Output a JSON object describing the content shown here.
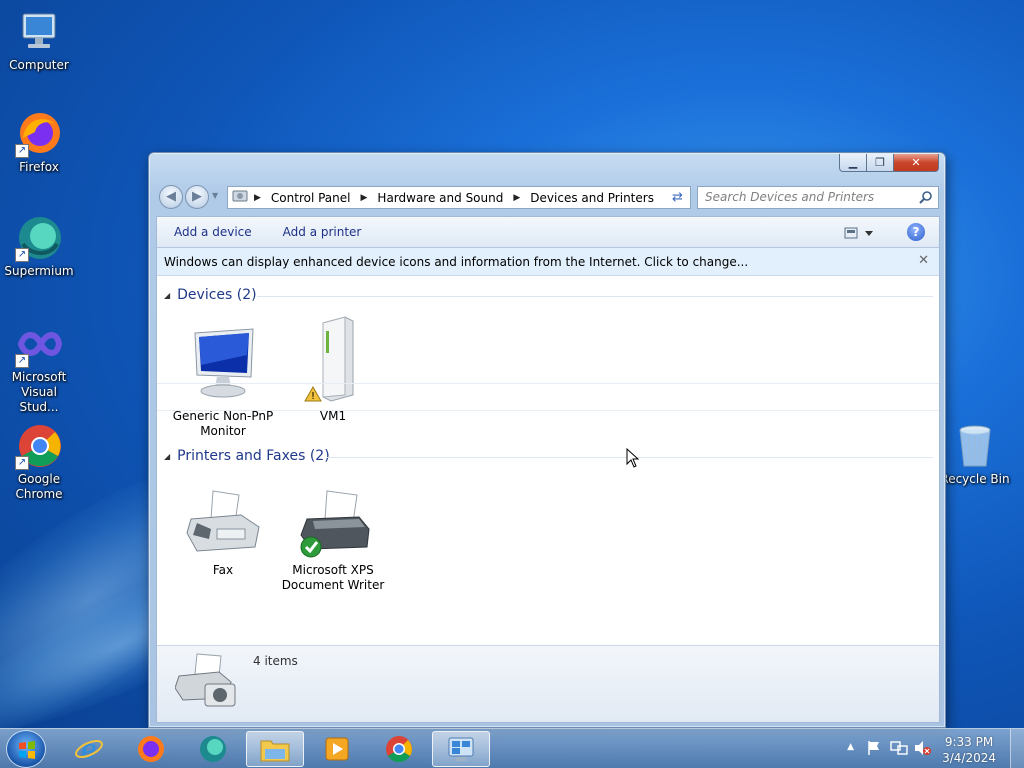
{
  "desktop": {
    "icons": [
      {
        "label": "Computer"
      },
      {
        "label": "Firefox"
      },
      {
        "label": "Supermium"
      },
      {
        "label": "Microsoft Visual Stud..."
      },
      {
        "label": "Google Chrome"
      },
      {
        "label": "Recycle Bin"
      }
    ]
  },
  "window": {
    "breadcrumb": [
      "Control Panel",
      "Hardware and Sound",
      "Devices and Printers"
    ],
    "search_placeholder": "Search Devices and Printers",
    "commands": {
      "add_device": "Add a device",
      "add_printer": "Add a printer"
    },
    "infobar_text": "Windows can display enhanced device icons and information from the Internet. Click to change...",
    "groups": [
      {
        "title": "Devices (2)",
        "items": [
          {
            "label": "Generic Non-PnP Monitor"
          },
          {
            "label": "VM1"
          }
        ]
      },
      {
        "title": "Printers and Faxes (2)",
        "items": [
          {
            "label": "Fax"
          },
          {
            "label": "Microsoft XPS Document Writer"
          }
        ]
      }
    ],
    "details_count": "4 items"
  },
  "taskbar": {
    "clock_time": "9:33 PM",
    "clock_date": "3/4/2024",
    "apps": [
      "internet-explorer",
      "firefox",
      "supermium",
      "file-explorer",
      "media-player",
      "chrome",
      "devices-and-printers"
    ]
  }
}
